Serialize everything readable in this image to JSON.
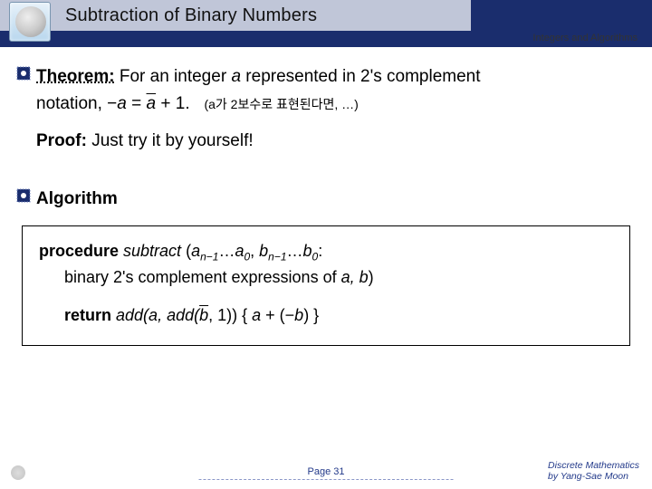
{
  "header": {
    "title": "Subtraction of Binary Numbers",
    "section": "Integers and Algorithms"
  },
  "theorem": {
    "label": "Theorem:",
    "text_1": "For an integer ",
    "var_a": "a",
    "text_2": " represented in 2's complement",
    "line2_pre": "notation, −",
    "line2_post": " = ",
    "line2_end": " + 1.",
    "note": "(a가 2보수로 표현된다면, …)"
  },
  "proof": {
    "label": "Proof:",
    "text": " Just try it by yourself!"
  },
  "algorithm": {
    "label": "Algorithm",
    "proc_kw": "procedure",
    "proc_name": " subtract ",
    "proc_args_open": "(",
    "a_var": "a",
    "a_sub1": "n−1",
    "ellipsis": "…",
    "a_sub0": "0",
    "comma": ", ",
    "b_var": "b",
    "b_sub1": "n−1",
    "b_sub0": "0",
    "proc_args_close": ":",
    "desc": "binary 2's complement expressions of ",
    "desc_vars": "a, b",
    "desc_close": ")",
    "return_kw": "return",
    "return_body_1": " add(",
    "return_body_2": ", add(",
    "return_body_3": ", 1))  { ",
    "return_body_4": " + (−",
    "return_body_5": ") }"
  },
  "footer": {
    "page": "Page 31",
    "credit1": "Discrete Mathematics",
    "credit2": "by Yang-Sae Moon"
  }
}
